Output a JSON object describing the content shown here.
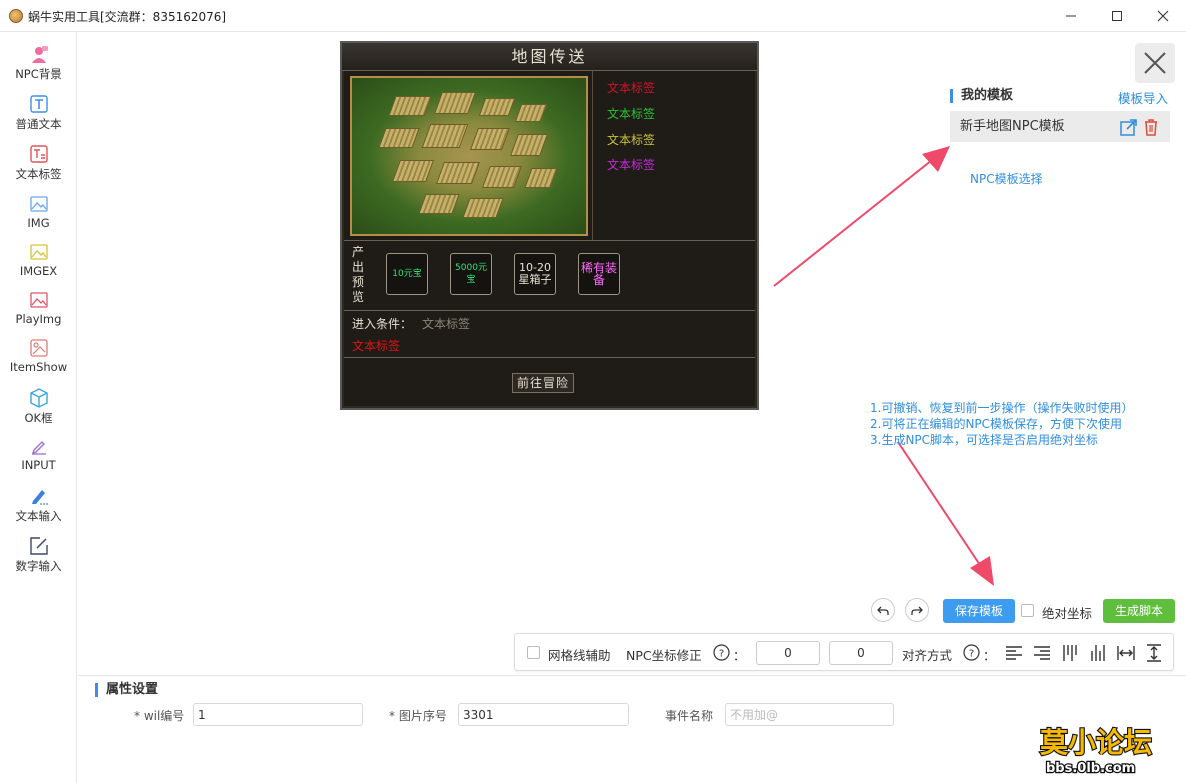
{
  "window": {
    "title": "蜗牛实用工具[交流群：835162076]"
  },
  "sidebar": {
    "items": [
      {
        "label": "NPC背景",
        "icon": "npc-background-icon"
      },
      {
        "label": "普通文本",
        "icon": "text-icon"
      },
      {
        "label": "文本标签",
        "icon": "text-label-icon"
      },
      {
        "label": "IMG",
        "icon": "image-icon"
      },
      {
        "label": "IMGEX",
        "icon": "image-ex-icon"
      },
      {
        "label": "PlayImg",
        "icon": "play-image-icon"
      },
      {
        "label": "ItemShow",
        "icon": "item-show-icon"
      },
      {
        "label": "OK框",
        "icon": "ok-box-icon"
      },
      {
        "label": "INPUT",
        "icon": "input-icon"
      },
      {
        "label": "文本输入",
        "icon": "text-input-icon"
      },
      {
        "label": "数字输入",
        "icon": "number-input-icon"
      }
    ]
  },
  "npc": {
    "title": "地图传送",
    "labels": [
      {
        "text": "文本标签",
        "color": "#d0142b"
      },
      {
        "text": "文本标签",
        "color": "#27c431"
      },
      {
        "text": "文本标签",
        "color": "#c9c23a"
      },
      {
        "text": "文本标签",
        "color": "#c52ad8"
      }
    ],
    "output_title": "产出预览",
    "slots": [
      {
        "text": "10元宝",
        "color": "#34e07a"
      },
      {
        "text": "5000元宝",
        "color": "#34e07a"
      },
      {
        "text": "10-20星箱子",
        "color": "#e8e2d4"
      },
      {
        "text": "稀有装备",
        "color": "#ff66ff"
      }
    ],
    "condition_label": "进入条件：",
    "condition_value": "文本标签",
    "red_label": "文本标签",
    "go_button": "前往冒险"
  },
  "templates": {
    "title": "我的模板",
    "import_link": "模板导入",
    "items": [
      {
        "name": "新手地图NPC模板"
      }
    ],
    "annotation": "NPC模板选择"
  },
  "notes": [
    "1.可撤销、恢复到前一步操作（操作失败时使用）",
    "2.可将正在编辑的NPC模板保存，方便下次使用",
    "3.生成NPC脚本，可选择是否启用绝对坐标"
  ],
  "actions": {
    "save": "保存模板",
    "absolute": "绝对坐标",
    "generate": "生成脚本"
  },
  "toolbar": {
    "grid_label": "网格线辅助",
    "npc_coord_label": "NPC坐标修正",
    "x_value": "0",
    "y_value": "0",
    "align_label": "对齐方式",
    "colon": "："
  },
  "props": {
    "title": "属性设置",
    "wil_label": "* wil编号",
    "wil_value": "1",
    "img_label": "* 图片序号",
    "img_value": "3301",
    "event_label": "事件名称",
    "event_placeholder": "不用加@"
  },
  "watermark": {
    "main": "莫小论坛",
    "sub": "bbs.0lb.com"
  }
}
